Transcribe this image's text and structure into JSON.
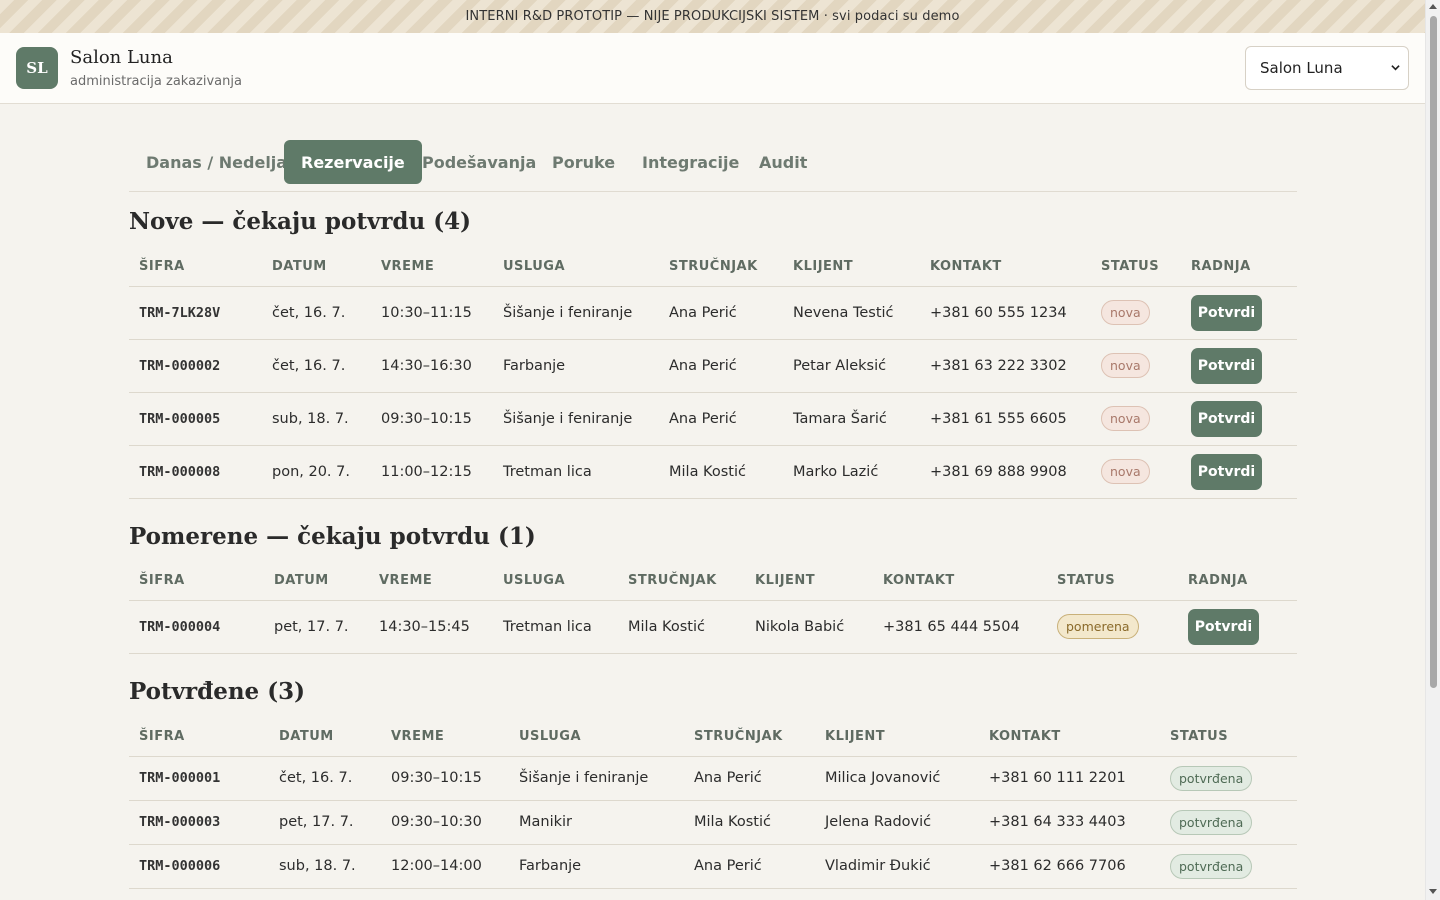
{
  "banner": {
    "text": "INTERNI R&D PROTOTIP — NIJE PRODUKCIJSKI SISTEM · svi podaci su demo"
  },
  "header": {
    "logo_initials": "SL",
    "brand_name": "Salon Luna",
    "brand_subtitle": "administracija zakazivanja",
    "salon_select_value": "Salon Luna"
  },
  "tabs": [
    {
      "label": "Danas / Nedelja",
      "active": false
    },
    {
      "label": "Rezervacije",
      "active": true
    },
    {
      "label": "Podešavanja",
      "active": false
    },
    {
      "label": "Poruke",
      "active": false
    },
    {
      "label": "Integracije",
      "active": false
    },
    {
      "label": "Audit",
      "active": false
    }
  ],
  "sections": {
    "nove": {
      "title": "Nove — čekaju potvrdu (4)",
      "headers": [
        "ŠIFRA",
        "DATUM",
        "VREME",
        "USLUGA",
        "STRUČNJAK",
        "KLIJENT",
        "KONTAKT",
        "STATUS",
        "RADNJA"
      ],
      "rows": [
        {
          "code": "TRM-7LK28V",
          "date": "čet, 16. 7.",
          "time": "10:30–11:15",
          "service": "Šišanje i feniranje",
          "expert": "Ana Perić",
          "client": "Nevena Testić",
          "contact": "+381 60 555 1234",
          "status": "nova",
          "action": "Potvrdi"
        },
        {
          "code": "TRM-000002",
          "date": "čet, 16. 7.",
          "time": "14:30–16:30",
          "service": "Farbanje",
          "expert": "Ana Perić",
          "client": "Petar Aleksić",
          "contact": "+381 63 222 3302",
          "status": "nova",
          "action": "Potvrdi"
        },
        {
          "code": "TRM-000005",
          "date": "sub, 18. 7.",
          "time": "09:30–10:15",
          "service": "Šišanje i feniranje",
          "expert": "Ana Perić",
          "client": "Tamara Šarić",
          "contact": "+381 61 555 6605",
          "status": "nova",
          "action": "Potvrdi"
        },
        {
          "code": "TRM-000008",
          "date": "pon, 20. 7.",
          "time": "11:00–12:15",
          "service": "Tretman lica",
          "expert": "Mila Kostić",
          "client": "Marko Lazić",
          "contact": "+381 69 888 9908",
          "status": "nova",
          "action": "Potvrdi"
        }
      ]
    },
    "pomerene": {
      "title": "Pomerene — čekaju potvrdu (1)",
      "headers": [
        "ŠIFRA",
        "DATUM",
        "VREME",
        "USLUGA",
        "STRUČNJAK",
        "KLIJENT",
        "KONTAKT",
        "STATUS",
        "RADNJA"
      ],
      "rows": [
        {
          "code": "TRM-000004",
          "date": "pet, 17. 7.",
          "time": "14:30–15:45",
          "service": "Tretman lica",
          "expert": "Mila Kostić",
          "client": "Nikola Babić",
          "contact": "+381 65 444 5504",
          "status": "pomerena",
          "action": "Potvrdi"
        }
      ]
    },
    "potvrdene": {
      "title": "Potvrđene (3)",
      "headers": [
        "ŠIFRA",
        "DATUM",
        "VREME",
        "USLUGA",
        "STRUČNJAK",
        "KLIJENT",
        "KONTAKT",
        "STATUS"
      ],
      "rows": [
        {
          "code": "TRM-000001",
          "date": "čet, 16. 7.",
          "time": "09:30–10:15",
          "service": "Šišanje i feniranje",
          "expert": "Ana Perić",
          "client": "Milica Jovanović",
          "contact": "+381 60 111 2201",
          "status": "potvrđena"
        },
        {
          "code": "TRM-000003",
          "date": "pet, 17. 7.",
          "time": "09:30–10:30",
          "service": "Manikir",
          "expert": "Mila Kostić",
          "client": "Jelena Radović",
          "contact": "+381 64 333 4403",
          "status": "potvrđena"
        },
        {
          "code": "TRM-000006",
          "date": "sub, 18. 7.",
          "time": "12:00–14:00",
          "service": "Farbanje",
          "expert": "Ana Perić",
          "client": "Vladimir Đukić",
          "contact": "+381 62 666 7706",
          "status": "potvrđena"
        }
      ]
    }
  },
  "colors": {
    "accent": "#5f7a68",
    "background": "#f5f3ee",
    "badge_nova": "#f5e6df",
    "badge_pomerena": "#f3e8cc",
    "badge_potvrdena": "#e2ebe2"
  }
}
